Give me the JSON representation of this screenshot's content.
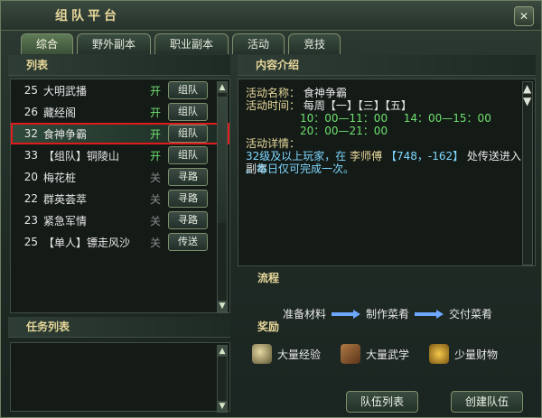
{
  "window": {
    "title": "组队平台"
  },
  "tabs": [
    {
      "label": "综合"
    },
    {
      "label": "野外副本"
    },
    {
      "label": "职业副本"
    },
    {
      "label": "活动"
    },
    {
      "label": "竞技"
    }
  ],
  "left": {
    "list_title": "列表",
    "items": [
      {
        "level": "25",
        "name": "大明武播",
        "status": "开",
        "button": "组队"
      },
      {
        "level": "26",
        "name": "藏经阁",
        "status": "开",
        "button": "组队"
      },
      {
        "level": "32",
        "name": "食神争霸",
        "status": "开",
        "button": "组队"
      },
      {
        "level": "33",
        "name": "【组队】铜陵山",
        "status": "开",
        "button": "组队"
      },
      {
        "level": "20",
        "name": "梅花桩",
        "status": "关",
        "button": "寻路"
      },
      {
        "level": "22",
        "name": "群英荟萃",
        "status": "关",
        "button": "寻路"
      },
      {
        "level": "23",
        "name": "紧急军情",
        "status": "关",
        "button": "寻路"
      },
      {
        "level": "25",
        "name": "【单人】镖走风沙",
        "status": "关",
        "button": "传送"
      }
    ],
    "task_title": "任务列表"
  },
  "right": {
    "detail_title": "内容介绍",
    "activity_name_label": "活动名称：",
    "activity_name": "食神争霸",
    "activity_time_label": "活动时间：",
    "activity_days": "每周【一】【三】【五】",
    "times": [
      "10：00—11：00",
      "14：00—15：00",
      "20：00—21：00"
    ],
    "details_label": "活动详情：",
    "details_line1_a": "32级及以上玩家，在",
    "details_line1_b": "李师傅",
    "details_line1_c": "【748，-162】",
    "details_line1_d": "处传送进入副本",
    "details_line2": "。每日仅可完成一次。",
    "flow_title": "流程",
    "flow_steps": [
      "准备材料",
      "制作菜肴",
      "交付菜肴"
    ],
    "reward_title": "奖励",
    "rewards": [
      "大量经验",
      "大量武学",
      "少量财物"
    ],
    "buttons": {
      "team_list": "队伍列表",
      "create_team": "创建队伍"
    }
  }
}
